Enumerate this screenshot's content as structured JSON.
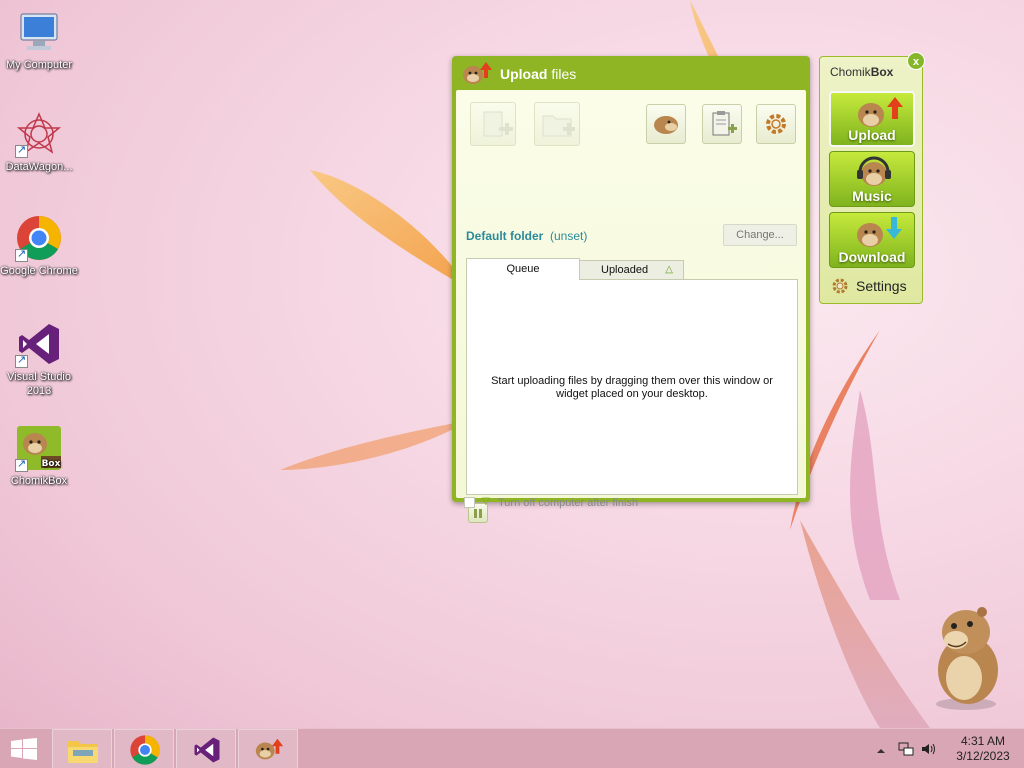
{
  "desktop": {
    "icons": [
      {
        "label": "My Computer"
      },
      {
        "label": "DataWagon..."
      },
      {
        "label": "Google Chrome"
      },
      {
        "label": "Visual Studio 2013"
      },
      {
        "label": "ChomikBox"
      }
    ]
  },
  "upload_window": {
    "title_bold": "Upload",
    "title_rest": " files",
    "default_folder_label": "Default folder",
    "default_folder_value": "(unset)",
    "change_label": "Change...",
    "tabs": [
      {
        "label": "Queue"
      },
      {
        "label": "Uploaded"
      }
    ],
    "queue_message": "Start uploading files by dragging them over this window or widget placed on your desktop.",
    "shutdown_label": "Turn off computer after finish"
  },
  "widget": {
    "title_regular": "Chomik",
    "title_bold": "Box",
    "close_label": "x",
    "buttons": [
      {
        "label": "Upload"
      },
      {
        "label": "Music"
      },
      {
        "label": "Download"
      }
    ],
    "settings_label": "Settings"
  },
  "taskbar": {
    "time": "4:31 AM",
    "date": "3/12/2023"
  },
  "colors": {
    "window_green": "#8fb524",
    "accent_teal": "#2b8a9a",
    "taskbar": "#d9a6b6"
  }
}
